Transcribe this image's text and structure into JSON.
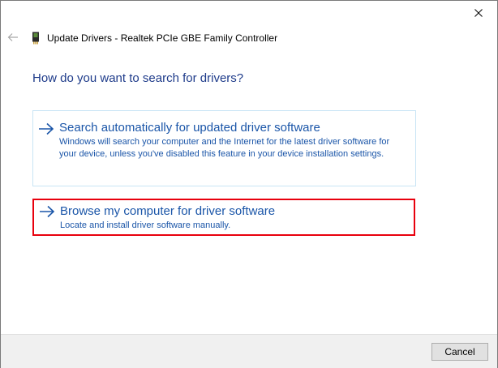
{
  "window": {
    "title": "Update Drivers - Realtek PCIe GBE Family Controller",
    "close_icon": "close-icon",
    "back_icon": "back-arrow-icon",
    "device_icon": "network-adapter-icon"
  },
  "main": {
    "heading": "How do you want to search for drivers?",
    "options": [
      {
        "icon": "arrow-right-icon",
        "title": "Search automatically for updated driver software",
        "description": "Windows will search your computer and the Internet for the latest driver software for your device, unless you've disabled this feature in your device installation settings."
      },
      {
        "icon": "arrow-right-icon",
        "title": "Browse my computer for driver software",
        "description": "Locate and install driver software manually.",
        "highlighted": true
      }
    ]
  },
  "footer": {
    "cancel_label": "Cancel"
  },
  "colors": {
    "link_blue": "#1a55a8",
    "heading_blue": "#1e3b8a",
    "highlight_red": "#e8000d",
    "option_border": "#c8e4f5"
  }
}
